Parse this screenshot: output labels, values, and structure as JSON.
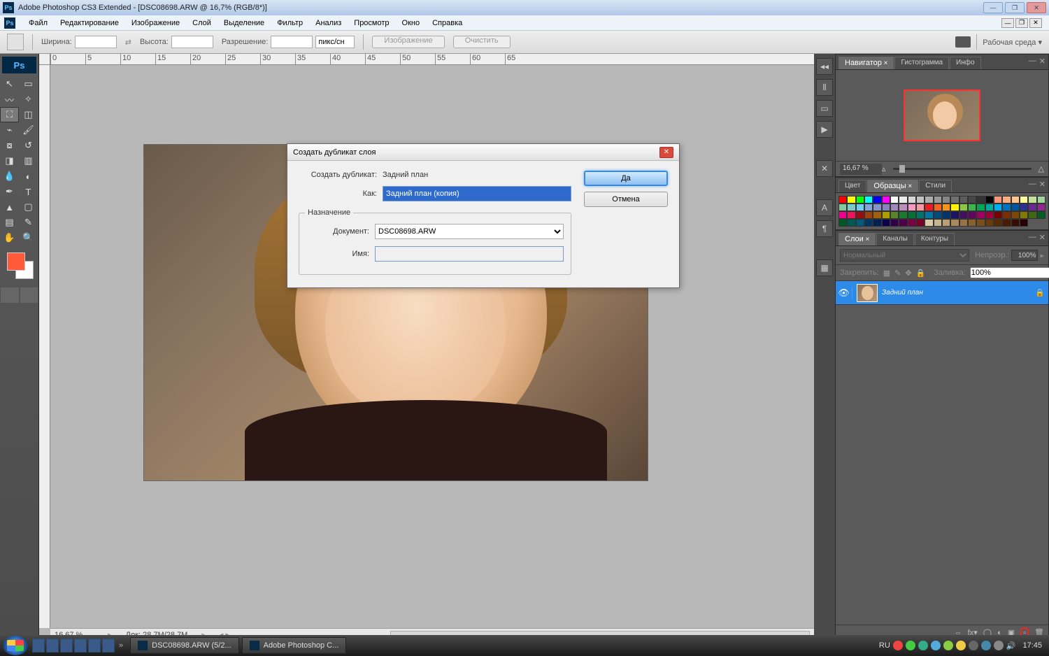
{
  "titlebar": {
    "app_icon": "Ps",
    "title": "Adobe Photoshop CS3 Extended - [DSC08698.ARW @ 16,7% (RGB/8*)]"
  },
  "menu": {
    "icon": "Ps",
    "items": [
      "Файл",
      "Редактирование",
      "Изображение",
      "Слой",
      "Выделение",
      "Фильтр",
      "Анализ",
      "Просмотр",
      "Окно",
      "Справка"
    ]
  },
  "optionbar": {
    "width_label": "Ширина:",
    "height_label": "Высота:",
    "res_label": "Разрешение:",
    "units": "пикс/сн",
    "btn_image": "Изображение",
    "btn_clear": "Очистить",
    "workspace_label": "Рабочая среда ▾"
  },
  "status": {
    "zoom": "16,67 %",
    "doc": "Док: 28,7M/28,7M"
  },
  "dialog": {
    "title": "Создать дубликат слоя",
    "dup_label": "Создать дубликат:",
    "dup_value": "Задний план",
    "as_label": "Как:",
    "as_value": "Задний план (копия)",
    "dest_legend": "Назначение",
    "doc_label": "Документ:",
    "doc_value": "DSC08698.ARW",
    "name_label": "Имя:",
    "name_value": "",
    "ok": "Да",
    "cancel": "Отмена"
  },
  "panels": {
    "nav": {
      "tabs": [
        "Навигатор",
        "Гистограмма",
        "Инфо"
      ],
      "zoom": "16,67 %"
    },
    "color": {
      "tabs": [
        "Цвет",
        "Образцы",
        "Стили"
      ]
    },
    "layers": {
      "tabs": [
        "Слои",
        "Каналы",
        "Контуры"
      ],
      "blend": "Нормальный",
      "opacity_label": "Непрозр.:",
      "opacity": "100%",
      "lock_label": "Закрепить:",
      "fill_label": "Заливка:",
      "fill": "100%",
      "layer_name": "Задний план"
    }
  },
  "ruler_ticks": [
    "0",
    "5",
    "10",
    "15",
    "20",
    "25",
    "30",
    "35",
    "40",
    "45",
    "50",
    "55",
    "60",
    "65"
  ],
  "taskbar": {
    "btn1": "DSC08698.ARW (5/2...",
    "btn2": "Adobe Photoshop C...",
    "lang": "RU",
    "clock": "17:45"
  },
  "swatch_colors": [
    "#ff0000",
    "#ffff00",
    "#00ff00",
    "#00ffff",
    "#0000ff",
    "#ff00ff",
    "#ffffff",
    "#ebebeb",
    "#d6d6d6",
    "#c2c2c2",
    "#adadad",
    "#999999",
    "#858585",
    "#707070",
    "#5c5c5c",
    "#474747",
    "#333333",
    "#000000",
    "#f7977a",
    "#fbad82",
    "#fdc68c",
    "#fff799",
    "#c4df9b",
    "#a2d39c",
    "#82ca9d",
    "#7accc8",
    "#6ecff6",
    "#7ea7d8",
    "#8493ca",
    "#8882be",
    "#a187be",
    "#bc8dbf",
    "#f49ac2",
    "#f6989d",
    "#ed1c24",
    "#f26522",
    "#f7941d",
    "#fff200",
    "#8dc73f",
    "#39b54a",
    "#00a651",
    "#00a99d",
    "#00aeef",
    "#0072bc",
    "#0054a6",
    "#2e3192",
    "#662d91",
    "#92278f",
    "#ec008c",
    "#ed145b",
    "#9e0b0f",
    "#a0410d",
    "#a36209",
    "#aba000",
    "#598527",
    "#1a7b30",
    "#007236",
    "#00746b",
    "#0076a3",
    "#004b80",
    "#003471",
    "#1b1464",
    "#440e62",
    "#630460",
    "#9e005d",
    "#9e0039",
    "#790000",
    "#7b2e00",
    "#7d4900",
    "#827b00",
    "#406618",
    "#005e20",
    "#005826",
    "#005952",
    "#005b7f",
    "#003663",
    "#002157",
    "#0d004c",
    "#32004b",
    "#4b0049",
    "#7b0046",
    "#7a0026",
    "#d8cba6",
    "#c8b48c",
    "#b8a074",
    "#a8885c",
    "#987244",
    "#88602e",
    "#784e1b",
    "#683c0a",
    "#582a00",
    "#481a00",
    "#380c00",
    "#280000"
  ]
}
